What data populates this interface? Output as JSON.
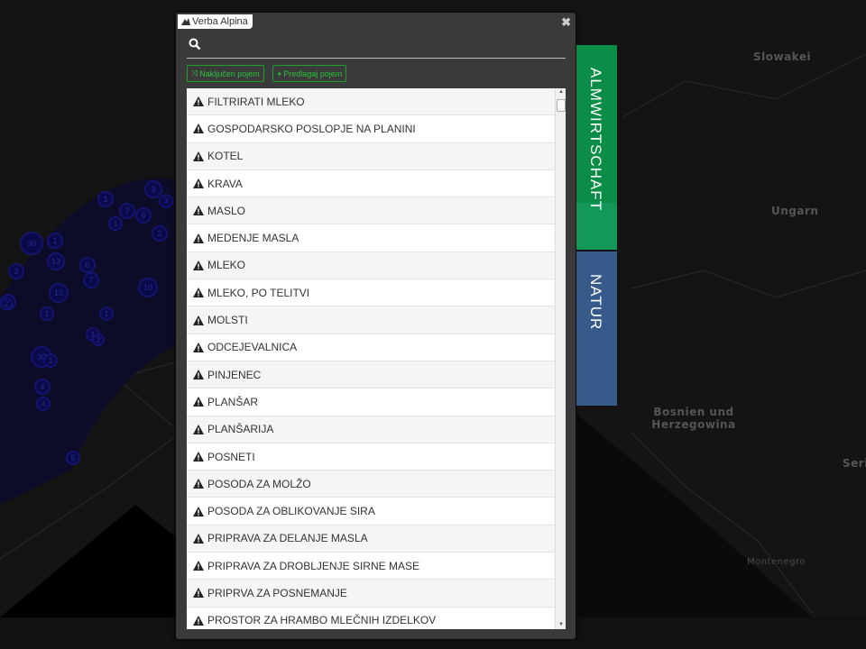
{
  "map": {
    "labels": [
      "Slowakei",
      "Ungarn",
      "Bosnien und Herzegowina",
      "Montenegro",
      "Seri"
    ],
    "markers": [
      "30",
      "1",
      "13",
      "6",
      "10",
      "7",
      "3",
      "1",
      "2",
      "4",
      "1",
      "3",
      "6",
      "2",
      "1",
      "1",
      "2",
      "30",
      "1",
      "4",
      "2",
      "5",
      "10",
      "7",
      "1",
      "3"
    ]
  },
  "dialog": {
    "tab_label": "Verba Alpina",
    "close_icon": "times-icon",
    "search": {
      "value": "",
      "placeholder": ""
    },
    "buttons": {
      "random": "Naključen pojem",
      "suggest": "Predlagaj pojem"
    },
    "items": [
      "FILTRIRATI MLEKO",
      "GOSPODARSKO POSLOPJE NA PLANINI",
      "KOTEL",
      "KRAVA",
      "MASLO",
      "MEDENJE MASLA",
      "MLEKO",
      "MLEKO, PO TELITVI",
      "MOLSTI",
      "ODCEJEVALNICA",
      "PINJENEC",
      "PLANŠAR",
      "PLANŠARIJA",
      "POSNETI",
      "POSODA ZA MOLŽO",
      "POSODA ZA OBLIKOVANJE SIRA",
      "PRIPRAVA ZA DELANJE MASLA",
      "PRIPRAVA ZA DROBLJENJE SIRNE MASE",
      "PRIPRVA ZA POSNEMANJE",
      "PROSTOR ZA HRAMBO MLEČNIH IZDELKOV"
    ]
  },
  "side_tabs": [
    {
      "label": "ALMWIRTSCHAFT",
      "color": "#0b8c47"
    },
    {
      "label": "NATUR",
      "color": "#365a8a"
    }
  ]
}
